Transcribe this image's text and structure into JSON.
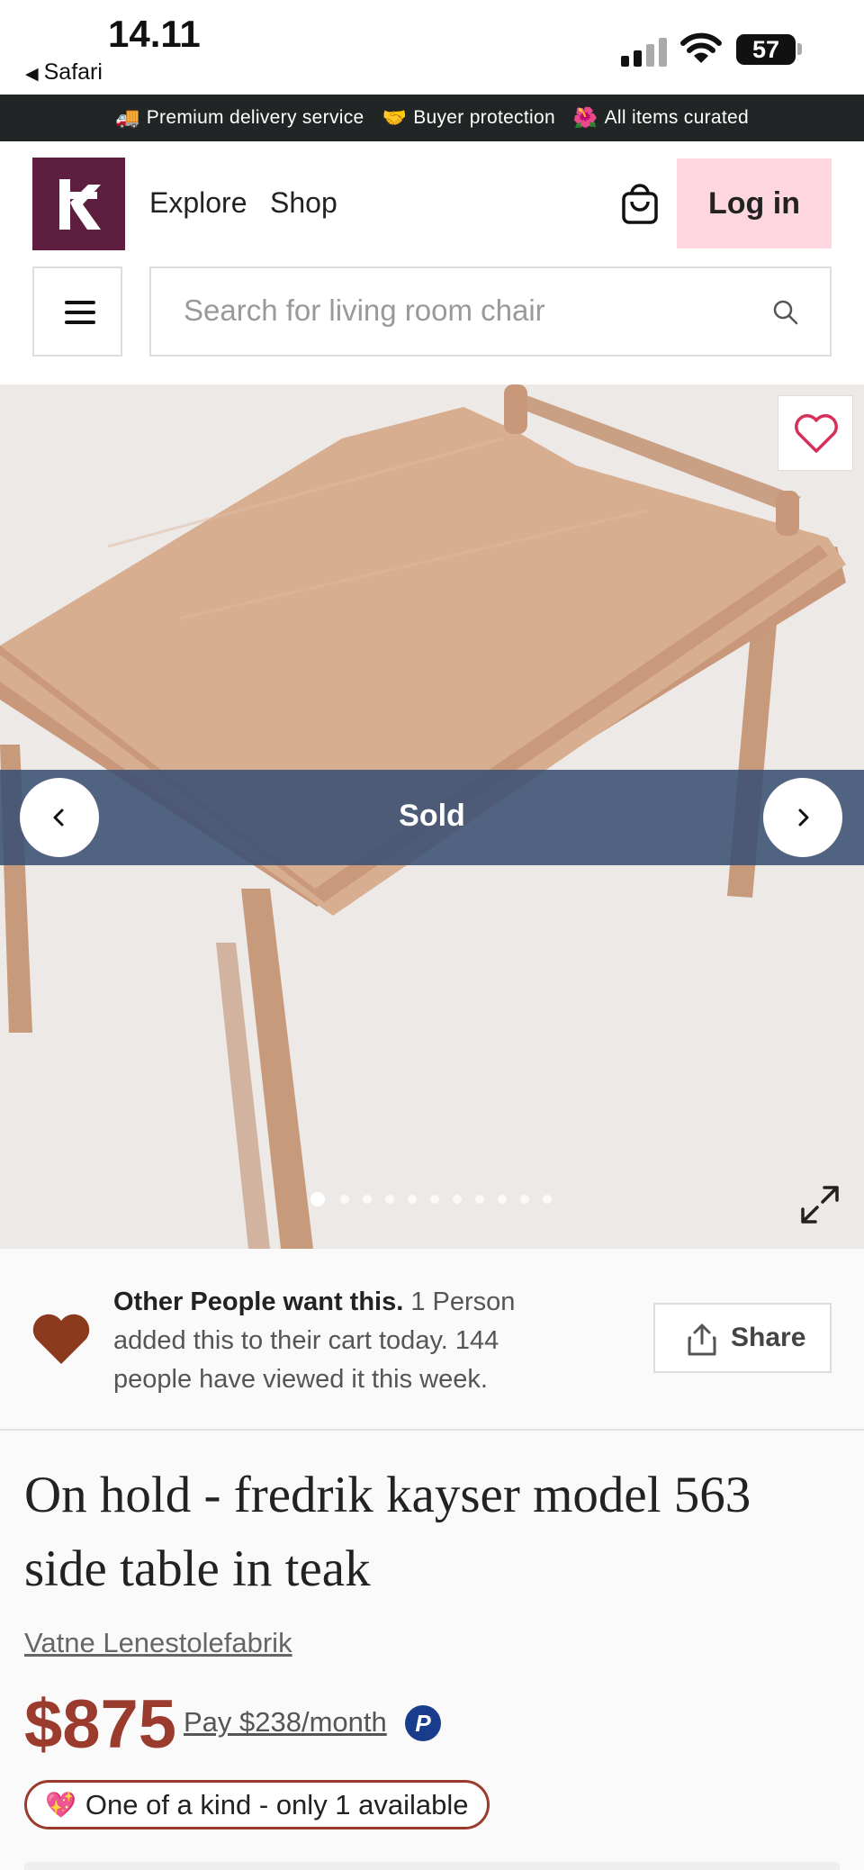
{
  "status_bar": {
    "time": "14.11",
    "back_app": "Safari",
    "battery": "57"
  },
  "promo_bar": {
    "items": [
      {
        "emoji": "🚚",
        "label": "Premium delivery service"
      },
      {
        "emoji": "🤝",
        "label": "Buyer protection"
      },
      {
        "emoji": "🌺",
        "label": "All items curated"
      }
    ]
  },
  "header": {
    "nav": {
      "explore": "Explore",
      "shop": "Shop"
    },
    "login_label": "Log in",
    "search_placeholder": "Search for living room chair"
  },
  "gallery": {
    "status_label": "Sold",
    "image_count": 11,
    "active_image": 1
  },
  "social_proof": {
    "headline": "Other People want this.",
    "body": "1 Person added this to their cart today. 144 people have viewed it this week.",
    "share_label": "Share"
  },
  "product": {
    "title": "On hold - fredrik kayser model 563 side table in teak",
    "brand": "Vatne Lenestolefabrik",
    "price": "$875",
    "installment": "Pay $238/month",
    "payment_badge": "P",
    "availability_emoji": "💖",
    "availability": "One of a kind - only 1 available"
  },
  "colors": {
    "brand": "#5e1e3f",
    "login_bg": "#fdd6df",
    "price": "#9b3b2e",
    "sold_band": "#3a5073",
    "heart_social": "#8b3a1e",
    "favorite_heart": "#d6305a"
  }
}
